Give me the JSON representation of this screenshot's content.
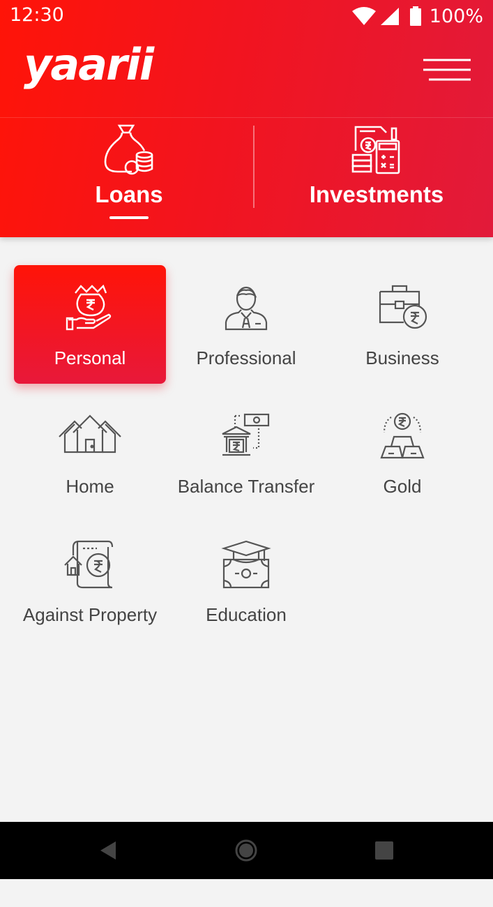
{
  "status_bar": {
    "time": "12:30",
    "battery": "100%",
    "icons": [
      "wifi-icon",
      "signal-icon",
      "battery-icon"
    ]
  },
  "header": {
    "brand": "yaarii",
    "menu_icon": "hamburger-menu-icon"
  },
  "tabs": [
    {
      "label": "Loans",
      "icon": "money-bag-coins-icon",
      "active": true
    },
    {
      "label": "Investments",
      "icon": "calculator-document-icon",
      "active": false
    }
  ],
  "loan_types": [
    {
      "label": "Personal",
      "icon": "hand-money-bag-icon",
      "active": true
    },
    {
      "label": "Professional",
      "icon": "professional-person-icon",
      "active": false
    },
    {
      "label": "Business",
      "icon": "briefcase-rupee-icon",
      "active": false
    },
    {
      "label": "Home",
      "icon": "houses-icon",
      "active": false
    },
    {
      "label": "Balance Transfer",
      "icon": "bank-transfer-icon",
      "active": false
    },
    {
      "label": "Gold",
      "icon": "gold-bars-icon",
      "active": false
    },
    {
      "label": "Against Property",
      "icon": "property-document-icon",
      "active": false
    },
    {
      "label": "Education",
      "icon": "graduation-cap-icon",
      "active": false
    }
  ],
  "colors": {
    "primary": "#f2141f",
    "gradient_start": "#ff1408",
    "gradient_end": "#e21a3a",
    "background": "#f3f3f3",
    "text": "#444444",
    "icon_stroke": "#555555"
  },
  "nav_bar": {
    "buttons": [
      "back-icon",
      "home-icon",
      "recents-icon"
    ]
  }
}
